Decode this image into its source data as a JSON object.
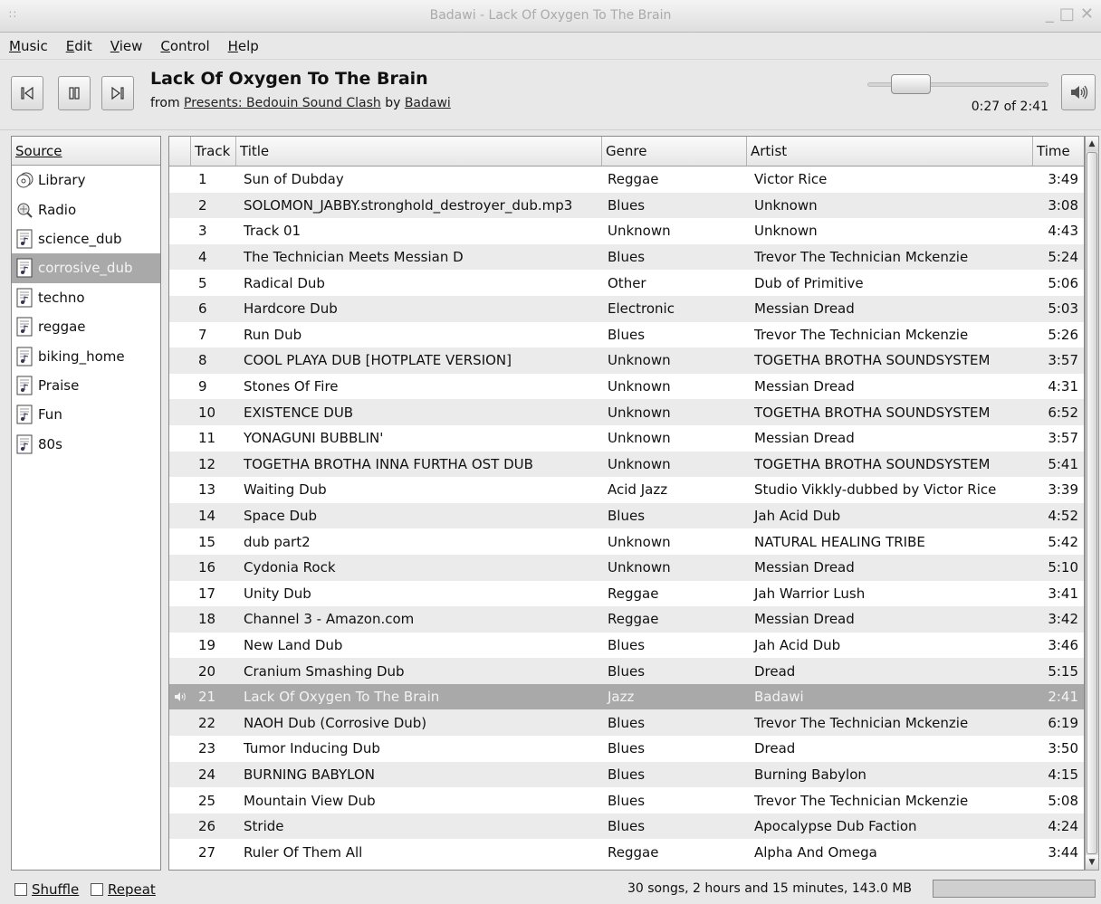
{
  "window": {
    "title": "Badawi - Lack Of Oxygen To The Brain"
  },
  "menu": [
    "Music",
    "Edit",
    "View",
    "Control",
    "Help"
  ],
  "player": {
    "song_title": "Lack Of Oxygen To The Brain",
    "from_label": "from",
    "album": "Presents: Bedouin Sound Clash",
    "by_label": "by",
    "artist": "Badawi",
    "time_readout": "0:27 of 2:41",
    "position_fraction": 0.168
  },
  "sources": {
    "header": "Source",
    "items": [
      {
        "label": "Library",
        "icon": "library-icon"
      },
      {
        "label": "Radio",
        "icon": "radio-icon"
      },
      {
        "label": "science_dub",
        "icon": "playlist-icon"
      },
      {
        "label": "corrosive_dub",
        "icon": "playlist-icon",
        "selected": true
      },
      {
        "label": "techno",
        "icon": "playlist-icon"
      },
      {
        "label": "reggae",
        "icon": "playlist-icon"
      },
      {
        "label": "biking_home",
        "icon": "playlist-icon"
      },
      {
        "label": "Praise",
        "icon": "playlist-icon"
      },
      {
        "label": "Fun",
        "icon": "playlist-icon"
      },
      {
        "label": "80s",
        "icon": "playlist-icon"
      }
    ]
  },
  "tracks": {
    "columns": {
      "track": "Track",
      "title": "Title",
      "genre": "Genre",
      "artist": "Artist",
      "time": "Time"
    },
    "rows": [
      {
        "n": "1",
        "title": "Sun of Dubday",
        "genre": "Reggae",
        "artist": "Victor Rice",
        "time": "3:49"
      },
      {
        "n": "2",
        "title": "SOLOMON_JABBY.stronghold_destroyer_dub.mp3",
        "genre": "Blues",
        "artist": "Unknown",
        "time": "3:08"
      },
      {
        "n": "3",
        "title": "Track 01",
        "genre": "Unknown",
        "artist": "Unknown",
        "time": "4:43"
      },
      {
        "n": "4",
        "title": "The Technician Meets Messian D",
        "genre": "Blues",
        "artist": "Trevor The Technician Mckenzie",
        "time": "5:24"
      },
      {
        "n": "5",
        "title": "Radical Dub",
        "genre": "Other",
        "artist": "Dub of Primitive",
        "time": "5:06"
      },
      {
        "n": "6",
        "title": "Hardcore Dub",
        "genre": "Electronic",
        "artist": "Messian Dread",
        "time": "5:03"
      },
      {
        "n": "7",
        "title": "Run Dub",
        "genre": "Blues",
        "artist": "Trevor The Technician Mckenzie",
        "time": "5:26"
      },
      {
        "n": "8",
        "title": "COOL PLAYA DUB [HOTPLATE VERSION]",
        "genre": "Unknown",
        "artist": "TOGETHA BROTHA SOUNDSYSTEM",
        "time": "3:57"
      },
      {
        "n": "9",
        "title": "Stones Of Fire",
        "genre": "Unknown",
        "artist": "Messian Dread",
        "time": "4:31"
      },
      {
        "n": "10",
        "title": "EXISTENCE DUB",
        "genre": "Unknown",
        "artist": "TOGETHA BROTHA SOUNDSYSTEM",
        "time": "6:52"
      },
      {
        "n": "11",
        "title": "YONAGUNI BUBBLIN'",
        "genre": "Unknown",
        "artist": "Messian Dread",
        "time": "3:57"
      },
      {
        "n": "12",
        "title": "TOGETHA BROTHA INNA FURTHA OST DUB",
        "genre": "Unknown",
        "artist": "TOGETHA BROTHA SOUNDSYSTEM",
        "time": "5:41"
      },
      {
        "n": "13",
        "title": "Waiting Dub",
        "genre": "Acid Jazz",
        "artist": "Studio Vikkly-dubbed by Victor Rice",
        "time": "3:39"
      },
      {
        "n": "14",
        "title": "Space Dub",
        "genre": "Blues",
        "artist": "Jah Acid Dub",
        "time": "4:52"
      },
      {
        "n": "15",
        "title": "dub part2",
        "genre": "Unknown",
        "artist": "NATURAL HEALING TRIBE",
        "time": "5:42"
      },
      {
        "n": "16",
        "title": "Cydonia Rock",
        "genre": "Unknown",
        "artist": "Messian Dread",
        "time": "5:10"
      },
      {
        "n": "17",
        "title": "Unity Dub",
        "genre": "Reggae",
        "artist": "Jah Warrior Lush",
        "time": "3:41"
      },
      {
        "n": "18",
        "title": "Channel 3 - Amazon.com",
        "genre": "Reggae",
        "artist": "Messian Dread",
        "time": "3:42"
      },
      {
        "n": "19",
        "title": "New Land Dub",
        "genre": "Blues",
        "artist": "Jah Acid Dub",
        "time": "3:46"
      },
      {
        "n": "20",
        "title": "Cranium Smashing Dub",
        "genre": "Blues",
        "artist": "Dread",
        "time": "5:15"
      },
      {
        "n": "21",
        "title": "Lack Of Oxygen To The Brain",
        "genre": "Jazz",
        "artist": "Badawi",
        "time": "2:41",
        "playing": true
      },
      {
        "n": "22",
        "title": "NAOH Dub (Corrosive Dub)",
        "genre": "Blues",
        "artist": "Trevor The Technician Mckenzie",
        "time": "6:19"
      },
      {
        "n": "23",
        "title": "Tumor Inducing Dub",
        "genre": "Blues",
        "artist": "Dread",
        "time": "3:50"
      },
      {
        "n": "24",
        "title": "BURNING BABYLON",
        "genre": "Blues",
        "artist": "Burning Babylon",
        "time": "4:15"
      },
      {
        "n": "25",
        "title": "Mountain View Dub",
        "genre": "Blues",
        "artist": "Trevor The Technician Mckenzie",
        "time": "5:08"
      },
      {
        "n": "26",
        "title": "Stride",
        "genre": "Blues",
        "artist": "Apocalypse Dub Faction",
        "time": "4:24"
      },
      {
        "n": "27",
        "title": "Ruler Of Them All",
        "genre": "Reggae",
        "artist": "Alpha And Omega",
        "time": "3:44"
      }
    ]
  },
  "status": {
    "shuffle_label": "Shuffle",
    "repeat_label": "Repeat",
    "summary": "30 songs, 2 hours and 15 minutes, 143.0 MB"
  },
  "colors": {
    "selection": "#a9a9a9",
    "row_alt": "#ebebeb"
  }
}
